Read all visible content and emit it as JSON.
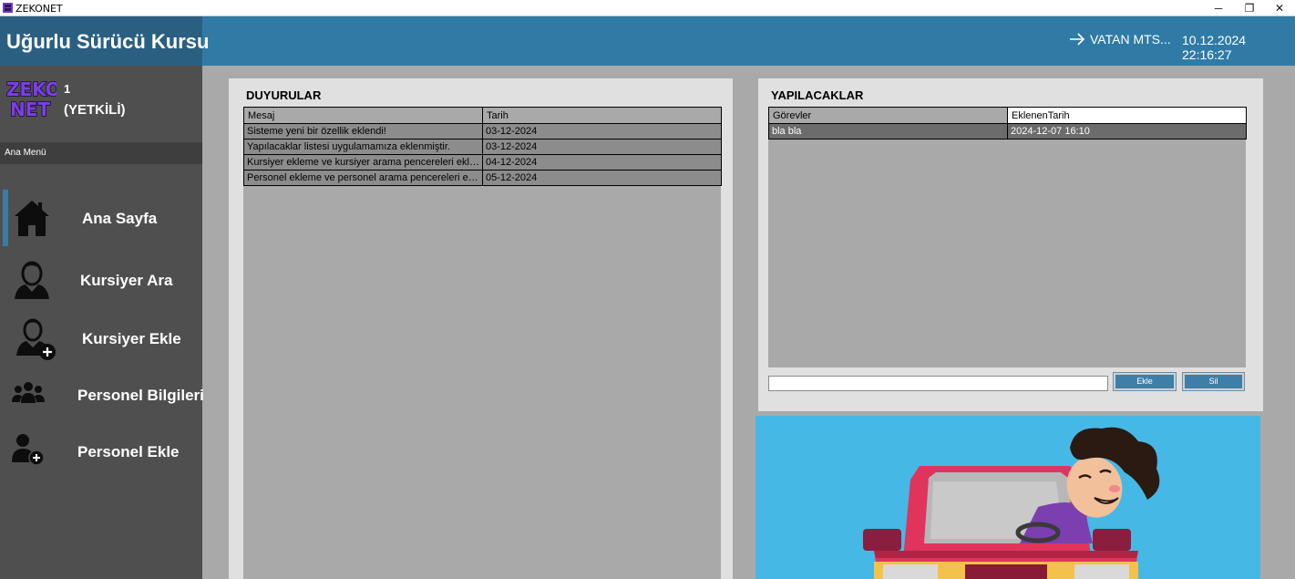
{
  "window": {
    "title": "ZEKONET",
    "controls": {
      "minimize": "─",
      "maximize": "❐",
      "close": "✕"
    }
  },
  "header": {
    "brand": "Uğurlu Sürücü Kursu",
    "user_name": "VATAN MTS...",
    "datetime": "10.12.2024 22:16:27"
  },
  "sidebar": {
    "logo_text": "ZEKO NET",
    "user_id": "1",
    "user_role": "(YETKİLİ)",
    "menu_caption": "Ana Menü",
    "items": [
      {
        "label": "Ana Sayfa",
        "icon": "home-icon",
        "active": true
      },
      {
        "label": "Kursiyer Ara",
        "icon": "user-search-icon",
        "active": false
      },
      {
        "label": "Kursiyer Ekle",
        "icon": "user-add-icon",
        "active": false
      },
      {
        "label": "Personel Bilgileri",
        "icon": "users-group-icon",
        "active": false
      },
      {
        "label": "Personel Ekle",
        "icon": "staff-add-icon",
        "active": false
      }
    ]
  },
  "announcements": {
    "title": "DUYURULAR",
    "columns": [
      "Mesaj",
      "Tarih"
    ],
    "rows": [
      [
        "Sisteme yeni bir özellik eklendi!",
        "03-12-2024"
      ],
      [
        "Yapılacaklar listesi uygulamamıza eklenmiştir.",
        "03-12-2024"
      ],
      [
        "Kursiyer ekleme ve kursiyer arama pencereleri ekle...",
        "04-12-2024"
      ],
      [
        "Personel ekleme ve personel arama pencereleri ekl...",
        "05-12-2024"
      ]
    ]
  },
  "todos": {
    "title": "YAPILACAKLAR",
    "columns": [
      "Görevler",
      "EklenenTarih"
    ],
    "rows": [
      [
        "bla bla",
        "2024-12-07 16:10"
      ]
    ],
    "input_value": "",
    "add_label": "Ekle",
    "delete_label": "Sil"
  },
  "colors": {
    "header_bg": "#307ba5",
    "brand_bg": "#2a5f81",
    "sidebar_bg": "#4f4f4f",
    "content_bg": "#a9a9a9",
    "panel_bg": "#e0e0e0",
    "accent": "#3a7ca5",
    "illustration_bg": "#46b8e5"
  }
}
